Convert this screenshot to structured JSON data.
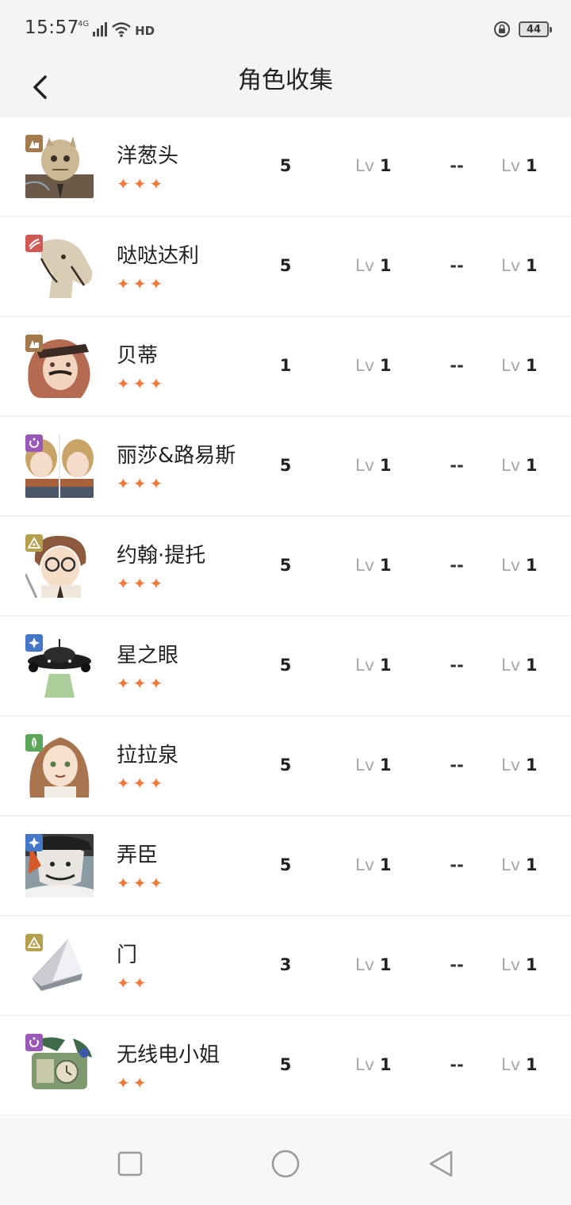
{
  "status": {
    "time": "15:57",
    "network": "4G",
    "hd_label": "HD",
    "battery": "44"
  },
  "header": {
    "back_icon": "chevron-left-icon",
    "title": "角色收集"
  },
  "colors": {
    "star": "#ef7a3a",
    "badge_brown": "#a27a4c",
    "badge_red": "#cf5a55",
    "badge_purple": "#9a59b8",
    "badge_olive": "#b4a04d",
    "badge_blue": "#4577c8",
    "badge_green": "#5ba65b"
  },
  "characters": [
    {
      "name": "洋葱头",
      "stars": "✦✦✦",
      "count": "5",
      "lv_prefix": "Lv",
      "lv_a": "1",
      "mid": "--",
      "lv_b": "1"
    },
    {
      "name": "哒哒达利",
      "stars": "✦✦✦",
      "count": "5",
      "lv_prefix": "Lv",
      "lv_a": "1",
      "mid": "--",
      "lv_b": "1"
    },
    {
      "name": "贝蒂",
      "stars": "✦✦✦",
      "count": "1",
      "lv_prefix": "Lv",
      "lv_a": "1",
      "mid": "--",
      "lv_b": "1"
    },
    {
      "name": "丽莎&路易斯",
      "stars": "✦✦✦",
      "count": "5",
      "lv_prefix": "Lv",
      "lv_a": "1",
      "mid": "--",
      "lv_b": "1"
    },
    {
      "name": "约翰·提托",
      "stars": "✦✦✦",
      "count": "5",
      "lv_prefix": "Lv",
      "lv_a": "1",
      "mid": "--",
      "lv_b": "1"
    },
    {
      "name": "星之眼",
      "stars": "✦✦✦",
      "count": "5",
      "lv_prefix": "Lv",
      "lv_a": "1",
      "mid": "--",
      "lv_b": "1"
    },
    {
      "name": "拉拉泉",
      "stars": "✦✦✦",
      "count": "5",
      "lv_prefix": "Lv",
      "lv_a": "1",
      "mid": "--",
      "lv_b": "1"
    },
    {
      "name": "弄臣",
      "stars": "✦✦✦",
      "count": "5",
      "lv_prefix": "Lv",
      "lv_a": "1",
      "mid": "--",
      "lv_b": "1"
    },
    {
      "name": "门",
      "stars": "✦✦",
      "count": "3",
      "lv_prefix": "Lv",
      "lv_a": "1",
      "mid": "--",
      "lv_b": "1"
    },
    {
      "name": "无线电小姐",
      "stars": "✦✦",
      "count": "5",
      "lv_prefix": "Lv",
      "lv_a": "1",
      "mid": "--",
      "lv_b": "1"
    }
  ],
  "nav": {
    "recents_icon": "square-icon",
    "home_icon": "circle-icon",
    "back_icon": "triangle-back-icon"
  }
}
